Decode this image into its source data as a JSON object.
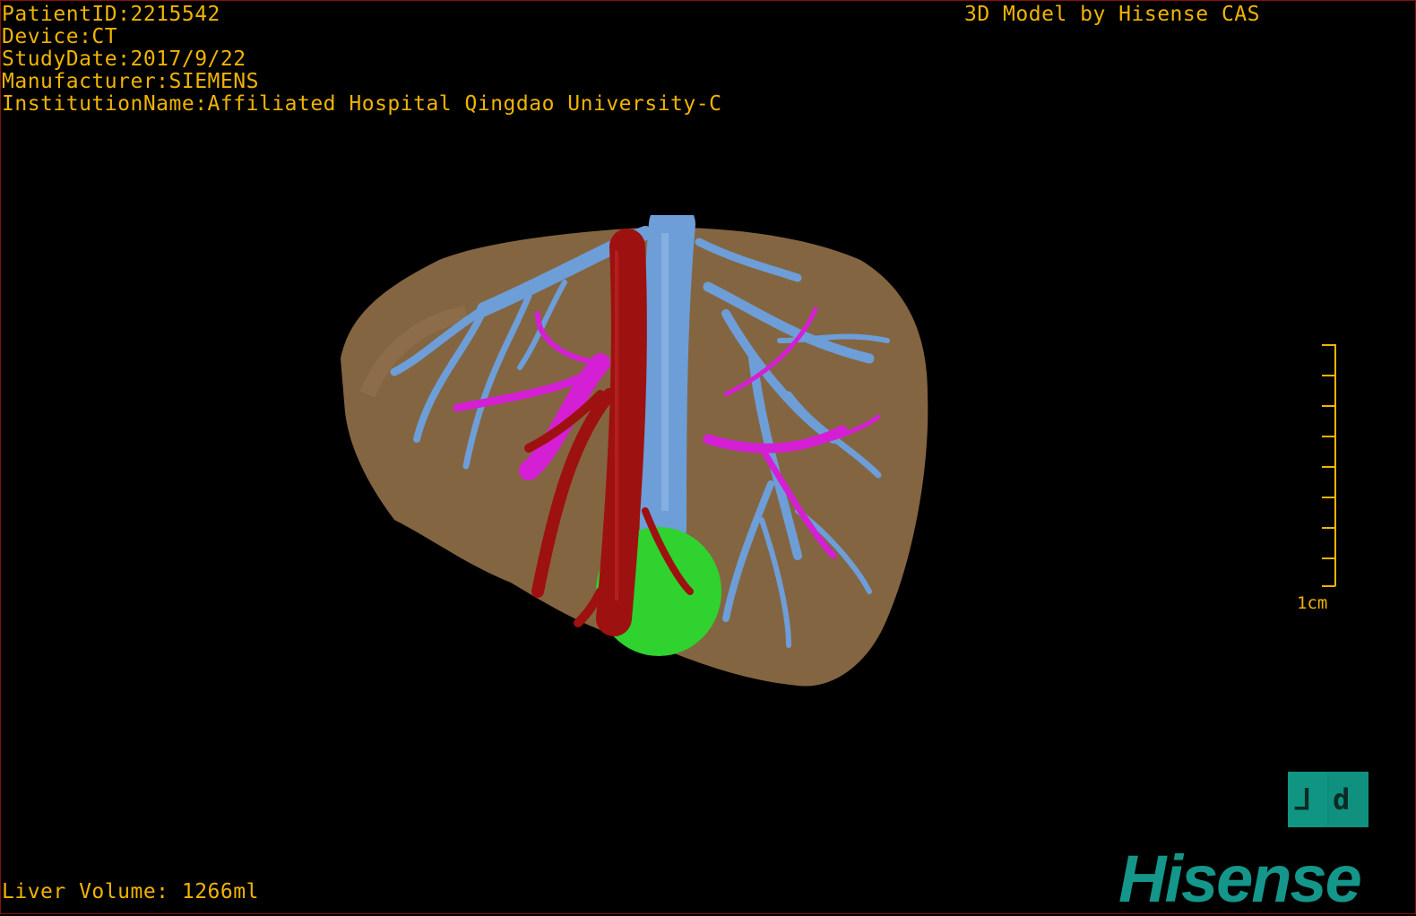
{
  "overlay": {
    "patient_id": "PatientID:2215542",
    "device": "Device:CT",
    "study_date": "StudyDate:2017/9/22",
    "manufacturer": "Manufacturer:SIEMENS",
    "institution": "InstitutionName:Affiliated Hospital Qingdao University-C",
    "model_credit": "3D Model by Hisense CAS",
    "liver_volume": "Liver Volume: 1266ml"
  },
  "scale_bar": {
    "label": "1cm"
  },
  "orientation_cube": {
    "left_glyph": "⅃",
    "right_glyph": "d"
  },
  "logo": {
    "text": "Hisense"
  },
  "colors": {
    "overlay_text": "#f0b400",
    "liver": "#8b6a45",
    "portal_vein": "#6d9ed8",
    "artery": "#9e1111",
    "hepatic_vein": "#d41fd4",
    "lesion": "#2fd22f",
    "brand": "#15968a"
  }
}
